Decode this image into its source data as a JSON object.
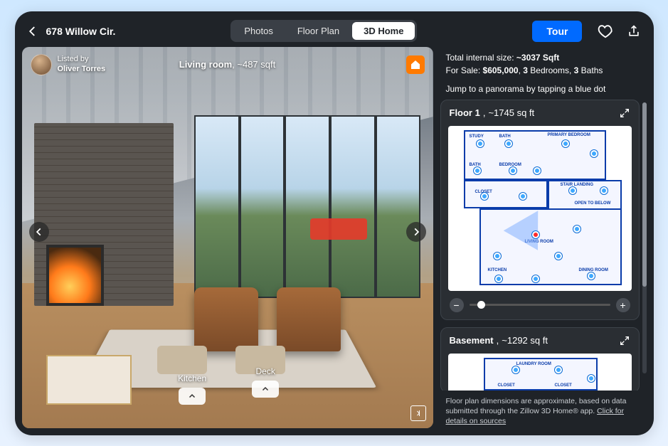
{
  "header": {
    "address": "678 Willow Cir.",
    "tabs": {
      "photos": "Photos",
      "floorplan": "Floor Plan",
      "home3d": "3D Home"
    },
    "tour_button": "Tour"
  },
  "viewer": {
    "listed_by_label": "Listed by",
    "agent_name": "Oliver Torres",
    "room_name": "Living room",
    "room_area": "~487 sqft",
    "hotspots": {
      "kitchen": "Kitchen",
      "deck": "Deck"
    }
  },
  "panel": {
    "total_label_prefix": "Total internal size: ",
    "total_size": "~3037 Sqft",
    "sale_prefix": "For Sale: ",
    "price": "$605,000",
    "beds_count": "3",
    "beds_label": " Bedrooms, ",
    "baths_count": "3",
    "baths_label": " Baths",
    "jump_hint": "Jump to a panorama by tapping a blue dot",
    "floors": [
      {
        "name": "Floor 1",
        "area": "~1745 sq ft",
        "rooms": [
          "STUDY",
          "BATH",
          "PRIMARY BEDROOM",
          "BATH",
          "BEDROOM",
          "CLOSET",
          "STAIR LANDING",
          "OPEN TO BELOW",
          "LIVING ROOM",
          "KITCHEN",
          "DINING ROOM"
        ]
      },
      {
        "name": "Basement",
        "area": "~1292 sq ft",
        "rooms": [
          "LAUNDRY ROOM",
          "CLOSET",
          "CLOSET"
        ]
      }
    ],
    "disclaimer_text": "Floor plan dimensions are approximate, based on data submitted through the Zillow 3D Home® app.  ",
    "disclaimer_link": "Click for details on sources"
  }
}
